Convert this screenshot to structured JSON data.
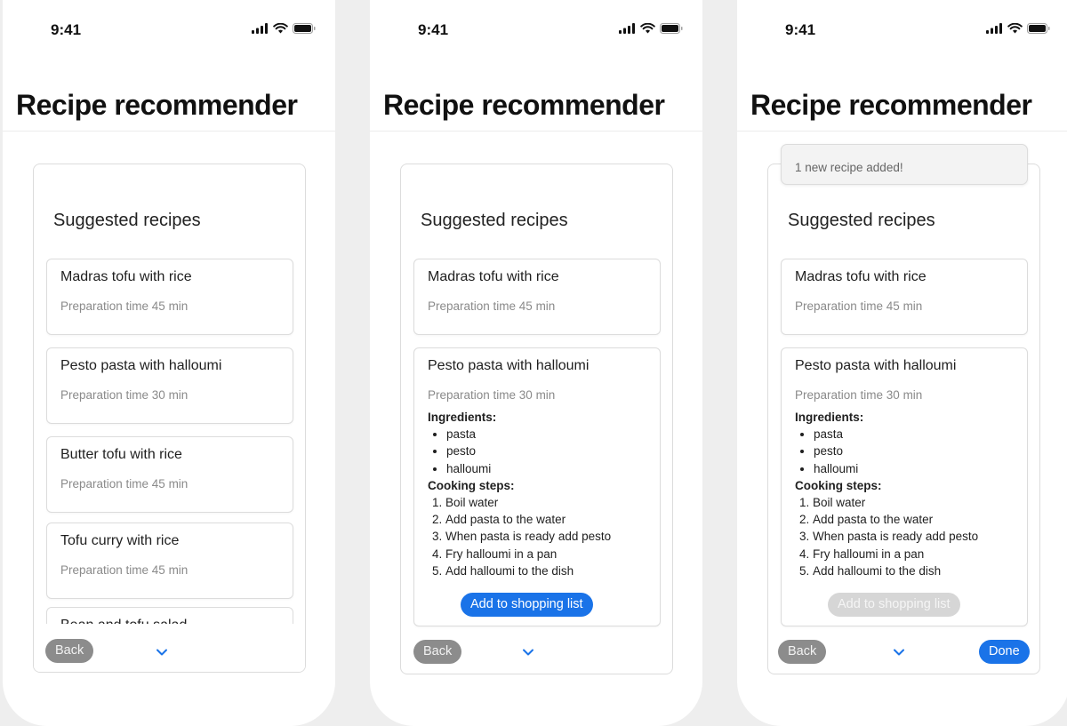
{
  "status": {
    "time": "9:41"
  },
  "app": {
    "title": "Recipe recommender"
  },
  "sheet": {
    "title": "Suggested recipes"
  },
  "recipes": [
    {
      "name": "Madras tofu with rice",
      "prep": "Preparation time 45 min"
    },
    {
      "name": "Pesto pasta with halloumi",
      "prep": "Preparation time 30 min"
    },
    {
      "name": "Butter tofu with rice",
      "prep": "Preparation time 45 min"
    },
    {
      "name": "Tofu curry with rice",
      "prep": "Preparation time 45 min"
    },
    {
      "name": "Bean and tofu salad",
      "prep": ""
    }
  ],
  "details": {
    "ingredients_label": "Ingredients:",
    "ingredients": [
      "pasta",
      "pesto",
      "halloumi"
    ],
    "steps_label": "Cooking steps:",
    "steps": [
      "Boil water",
      "Add pasta to the water",
      "When pasta is ready add pesto",
      "Fry halloumi in a pan",
      "Add halloumi to the dish"
    ]
  },
  "buttons": {
    "back": "Back",
    "add_to_list": "Add to shopping list",
    "done": "Done"
  },
  "toast": {
    "message": "1 new recipe added!"
  },
  "icons": {
    "signal": "cellular-signal-icon",
    "wifi": "wifi-icon",
    "battery": "battery-icon",
    "chevron": "chevron-down-icon"
  },
  "colors": {
    "accent": "#1a73e8",
    "back_button": "#8c8c8c",
    "disabled_button": "#d6d6d6"
  }
}
